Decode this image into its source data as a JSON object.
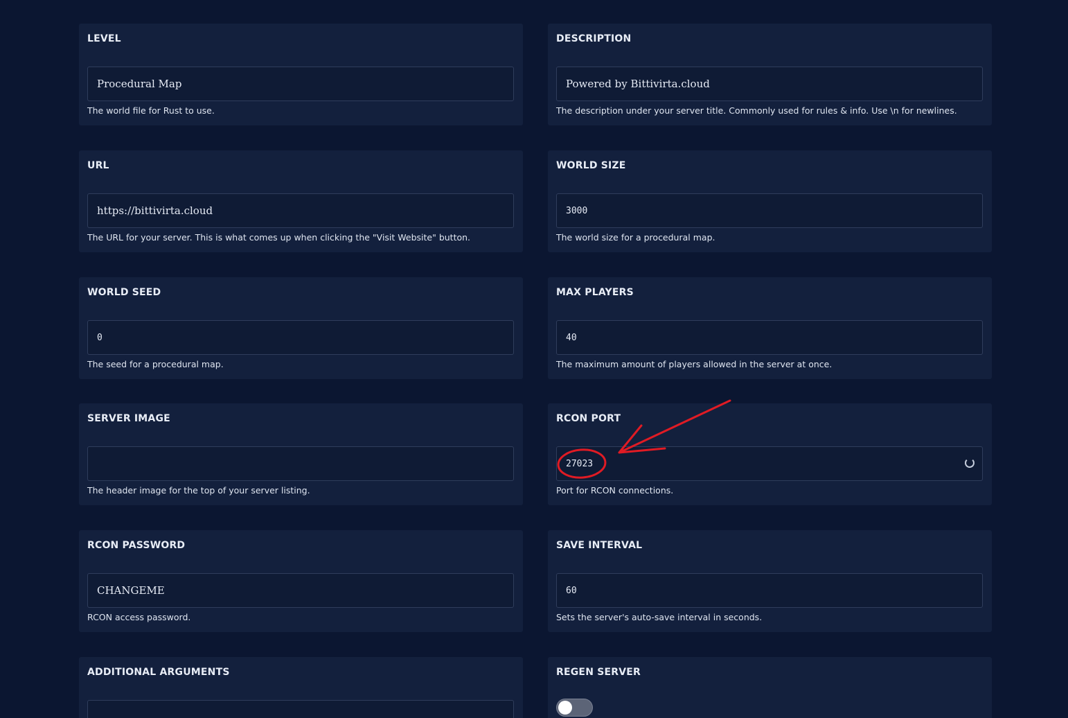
{
  "settings": [
    {
      "title": "LEVEL",
      "value": "Procedural Map",
      "help": "The world file for Rust to use."
    },
    {
      "title": "DESCRIPTION",
      "value": "Powered by Bittivirta.cloud",
      "help": "The description under your server title. Commonly used for rules & info. Use \\n for newlines."
    },
    {
      "title": "URL",
      "value": "https://bittivirta.cloud",
      "help": "The URL for your server. This is what comes up when clicking the \"Visit Website\" button."
    },
    {
      "title": "WORLD SIZE",
      "value": "3000",
      "help": "The world size for a procedural map."
    },
    {
      "title": "WORLD SEED",
      "value": "0",
      "help": "The seed for a procedural map."
    },
    {
      "title": "MAX PLAYERS",
      "value": "40",
      "help": "The maximum amount of players allowed in the server at once."
    },
    {
      "title": "SERVER IMAGE",
      "value": "",
      "help": "The header image for the top of your server listing."
    },
    {
      "title": "RCON PORT",
      "value": "27023",
      "help": "Port for RCON connections."
    },
    {
      "title": "RCON PASSWORD",
      "value": "CHANGEME",
      "help": "RCON access password."
    },
    {
      "title": "SAVE INTERVAL",
      "value": "60",
      "help": "Sets the server's auto-save interval in seconds."
    },
    {
      "title": "ADDITIONAL ARGUMENTS",
      "value": ""
    },
    {
      "title": "REGEN SERVER",
      "toggle_on": false
    }
  ],
  "icons": {
    "loading": "loading-spinner-icon"
  },
  "colors": {
    "background": "#0b1631",
    "card": "#13203d",
    "input_border": "#2f3d5c",
    "annotation": "#e01b24"
  }
}
